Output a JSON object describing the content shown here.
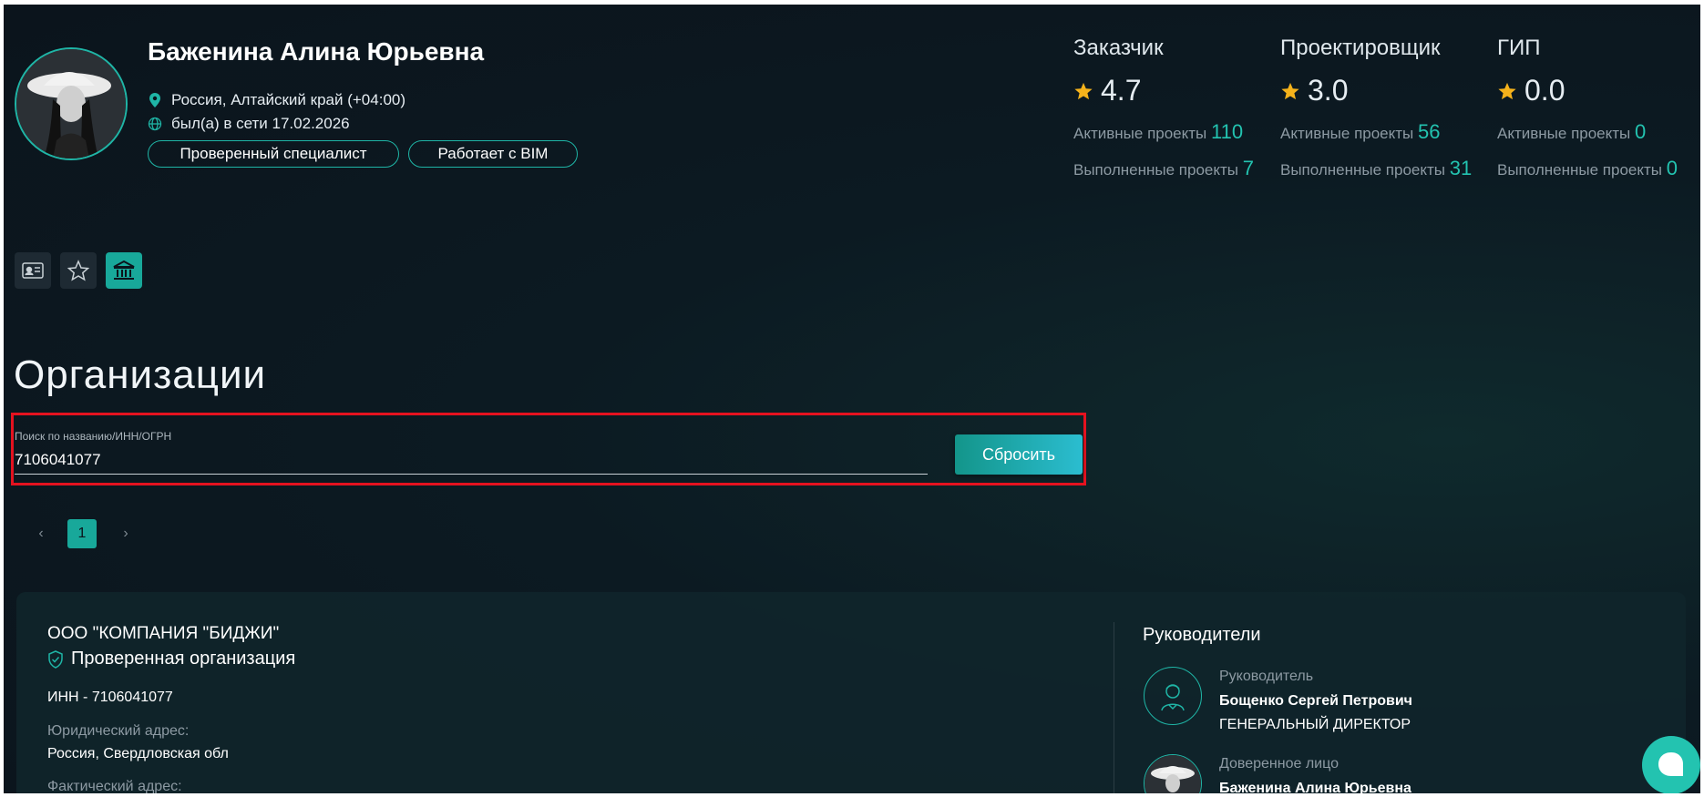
{
  "profile": {
    "name": "Баженина Алина Юрьевна",
    "location": "Россия, Алтайский край (+04:00)",
    "last_seen": "был(а) в сети 17.02.2026",
    "badges": [
      "Проверенный специалист",
      "Работает с BIM"
    ]
  },
  "stats": [
    {
      "role": "Заказчик",
      "rating": "4.7",
      "active_label": "Активные проекты",
      "active": "110",
      "done_label": "Выполненные проекты",
      "done": "7"
    },
    {
      "role": "Проектировщик",
      "rating": "3.0",
      "active_label": "Активные проекты",
      "active": "56",
      "done_label": "Выполненные проекты",
      "done": "31"
    },
    {
      "role": "ГИП",
      "rating": "0.0",
      "active_label": "Активные проекты",
      "active": "0",
      "done_label": "Выполненные проекты",
      "done": "0"
    }
  ],
  "tabs": [
    {
      "icon": "id-card-icon",
      "active": false
    },
    {
      "icon": "star-icon",
      "active": false
    },
    {
      "icon": "bank-icon",
      "active": true
    }
  ],
  "section": {
    "title": "Организации"
  },
  "search": {
    "label": "Поиск по названию/ИНН/ОГРН",
    "value": "7106041077",
    "reset_label": "Сбросить"
  },
  "pagination": {
    "prev": "‹",
    "current": "1",
    "next": "›"
  },
  "organization": {
    "name": "ООО \"КОМПАНИЯ \"БИДЖИ\"",
    "verified_label": "Проверенная организация",
    "inn": "ИНН - 7106041077",
    "legal_address_label": "Юридический адрес:",
    "legal_address": "Россия, Свердловская обл",
    "actual_address_label": "Фактический адрес:"
  },
  "leaders": {
    "title": "Руководители",
    "items": [
      {
        "role": "Руководитель",
        "name": "Бощенко Сергей Петрович",
        "position": "ГЕНЕРАЛЬНЫЙ ДИРЕКТОР"
      },
      {
        "role": "Доверенное лицо",
        "name": "Баженина Алина Юрьевна"
      }
    ]
  },
  "colors": {
    "accent": "#1fb5a6",
    "accent_number": "#23c3b0",
    "star": "#f5b21b",
    "highlight_border": "#e5121f",
    "background": "#0b141c"
  }
}
